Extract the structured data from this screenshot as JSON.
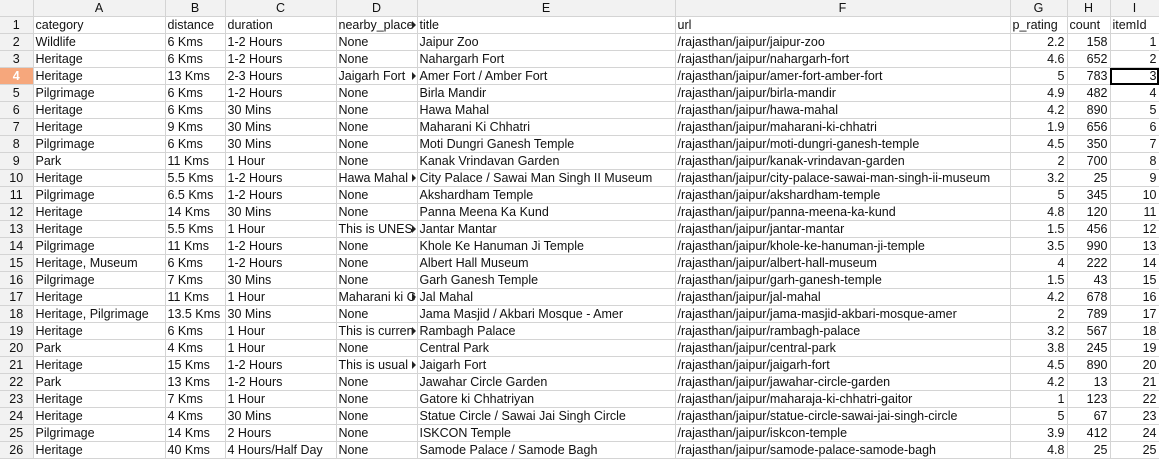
{
  "columns": [
    "A",
    "B",
    "C",
    "D",
    "E",
    "F",
    "G",
    "H",
    "I"
  ],
  "header_row": {
    "row_num": "1",
    "cells": [
      "category",
      "distance",
      "duration",
      "nearby_place",
      "title",
      "url",
      "p_rating",
      "count",
      "itemId"
    ]
  },
  "rows": [
    {
      "n": "2",
      "category": "Wildlife",
      "distance": "6 Kms",
      "duration": "1-2 Hours",
      "nearby": "None",
      "title": "Jaipur Zoo",
      "url": "/rajasthan/jaipur/jaipur-zoo",
      "rating": "2.2",
      "count": "158",
      "id": "1"
    },
    {
      "n": "3",
      "category": "Heritage",
      "distance": "6 Kms",
      "duration": "1-2 Hours",
      "nearby": "None",
      "title": "Nahargarh Fort",
      "url": "/rajasthan/jaipur/nahargarh-fort",
      "rating": "4.6",
      "count": "652",
      "id": "2"
    },
    {
      "n": "4",
      "category": "Heritage",
      "distance": "13 Kms",
      "duration": "2-3 Hours",
      "nearby": "Jaigarh Fort",
      "title": "Amer Fort / Amber Fort",
      "url": "/rajasthan/jaipur/amer-fort-amber-fort",
      "rating": "5",
      "count": "783",
      "id": "3"
    },
    {
      "n": "5",
      "category": "Pilgrimage",
      "distance": "6 Kms",
      "duration": "1-2 Hours",
      "nearby": "None",
      "title": "Birla Mandir",
      "url": "/rajasthan/jaipur/birla-mandir",
      "rating": "4.9",
      "count": "482",
      "id": "4"
    },
    {
      "n": "6",
      "category": "Heritage",
      "distance": "6 Kms",
      "duration": "30 Mins",
      "nearby": "None",
      "title": "Hawa Mahal",
      "url": "/rajasthan/jaipur/hawa-mahal",
      "rating": "4.2",
      "count": "890",
      "id": "5"
    },
    {
      "n": "7",
      "category": "Heritage",
      "distance": "9 Kms",
      "duration": "30 Mins",
      "nearby": "None",
      "title": "Maharani Ki Chhatri",
      "url": "/rajasthan/jaipur/maharani-ki-chhatri",
      "rating": "1.9",
      "count": "656",
      "id": "6"
    },
    {
      "n": "8",
      "category": "Pilgrimage",
      "distance": "6 Kms",
      "duration": "30 Mins",
      "nearby": "None",
      "title": "Moti Dungri Ganesh Temple",
      "url": "/rajasthan/jaipur/moti-dungri-ganesh-temple",
      "rating": "4.5",
      "count": "350",
      "id": "7"
    },
    {
      "n": "9",
      "category": "Park",
      "distance": "11 Kms",
      "duration": "1 Hour",
      "nearby": "None",
      "title": "Kanak Vrindavan Garden",
      "url": "/rajasthan/jaipur/kanak-vrindavan-garden",
      "rating": "2",
      "count": "700",
      "id": "8"
    },
    {
      "n": "10",
      "category": "Heritage",
      "distance": "5.5 Kms",
      "duration": "1-2 Hours",
      "nearby": "Hawa Mahal",
      "title": "City Palace / Sawai Man Singh II Museum",
      "url": "/rajasthan/jaipur/city-palace-sawai-man-singh-ii-museum",
      "rating": "3.2",
      "count": "25",
      "id": "9"
    },
    {
      "n": "11",
      "category": "Pilgrimage",
      "distance": "6.5 Kms",
      "duration": "1-2 Hours",
      "nearby": "None",
      "title": "Akshardham Temple",
      "url": "/rajasthan/jaipur/akshardham-temple",
      "rating": "5",
      "count": "345",
      "id": "10"
    },
    {
      "n": "12",
      "category": "Heritage",
      "distance": "14 Kms",
      "duration": "30 Mins",
      "nearby": "None",
      "title": "Panna Meena Ka Kund",
      "url": "/rajasthan/jaipur/panna-meena-ka-kund",
      "rating": "4.8",
      "count": "120",
      "id": "11"
    },
    {
      "n": "13",
      "category": "Heritage",
      "distance": "5.5 Kms",
      "duration": "1 Hour",
      "nearby": "This is UNES",
      "title": "Jantar Mantar",
      "url": "/rajasthan/jaipur/jantar-mantar",
      "rating": "1.5",
      "count": "456",
      "id": "12"
    },
    {
      "n": "14",
      "category": "Pilgrimage",
      "distance": "11 Kms",
      "duration": "1-2 Hours",
      "nearby": "None",
      "title": "Khole Ke Hanuman Ji Temple",
      "url": "/rajasthan/jaipur/khole-ke-hanuman-ji-temple",
      "rating": "3.5",
      "count": "990",
      "id": "13"
    },
    {
      "n": "15",
      "category": "Heritage, Museum",
      "distance": "6 Kms",
      "duration": "1-2 Hours",
      "nearby": "None",
      "title": "Albert Hall Museum",
      "url": "/rajasthan/jaipur/albert-hall-museum",
      "rating": "4",
      "count": "222",
      "id": "14"
    },
    {
      "n": "16",
      "category": "Pilgrimage",
      "distance": "7 Kms",
      "duration": "30 Mins",
      "nearby": "None",
      "title": "Garh Ganesh Temple",
      "url": "/rajasthan/jaipur/garh-ganesh-temple",
      "rating": "1.5",
      "count": "43",
      "id": "15"
    },
    {
      "n": "17",
      "category": "Heritage",
      "distance": "11 Kms",
      "duration": "1 Hour",
      "nearby": "Maharani ki C",
      "title": "Jal Mahal",
      "url": "/rajasthan/jaipur/jal-mahal",
      "rating": "4.2",
      "count": "678",
      "id": "16"
    },
    {
      "n": "18",
      "category": "Heritage, Pilgrimage",
      "distance": "13.5 Kms",
      "duration": "30 Mins",
      "nearby": "None",
      "title": "Jama Masjid / Akbari Mosque - Amer",
      "url": "/rajasthan/jaipur/jama-masjid-akbari-mosque-amer",
      "rating": "2",
      "count": "789",
      "id": "17"
    },
    {
      "n": "19",
      "category": "Heritage",
      "distance": "6 Kms",
      "duration": "1 Hour",
      "nearby": "This is curren",
      "title": "Rambagh Palace",
      "url": "/rajasthan/jaipur/rambagh-palace",
      "rating": "3.2",
      "count": "567",
      "id": "18"
    },
    {
      "n": "20",
      "category": "Park",
      "distance": "4 Kms",
      "duration": "1 Hour",
      "nearby": "None",
      "title": "Central Park",
      "url": "/rajasthan/jaipur/central-park",
      "rating": "3.8",
      "count": "245",
      "id": "19"
    },
    {
      "n": "21",
      "category": "Heritage",
      "distance": "15 Kms",
      "duration": "1-2 Hours",
      "nearby": "This is usual",
      "title": "Jaigarh Fort",
      "url": "/rajasthan/jaipur/jaigarh-fort",
      "rating": "4.5",
      "count": "890",
      "id": "20"
    },
    {
      "n": "22",
      "category": "Park",
      "distance": "13 Kms",
      "duration": "1-2 Hours",
      "nearby": "None",
      "title": "Jawahar Circle Garden",
      "url": "/rajasthan/jaipur/jawahar-circle-garden",
      "rating": "4.2",
      "count": "13",
      "id": "21"
    },
    {
      "n": "23",
      "category": "Heritage",
      "distance": "7 Kms",
      "duration": "1 Hour",
      "nearby": "None",
      "title": "Gatore ki Chhatriyan",
      "url": "/rajasthan/jaipur/maharaja-ki-chhatri-gaitor",
      "rating": "1",
      "count": "123",
      "id": "22"
    },
    {
      "n": "24",
      "category": "Heritage",
      "distance": "4 Kms",
      "duration": "30 Mins",
      "nearby": "None",
      "title": "Statue Circle / Sawai Jai Singh Circle",
      "url": "/rajasthan/jaipur/statue-circle-sawai-jai-singh-circle",
      "rating": "5",
      "count": "67",
      "id": "23"
    },
    {
      "n": "25",
      "category": "Pilgrimage",
      "distance": "14 Kms",
      "duration": "2 Hours",
      "nearby": "None",
      "title": "ISKCON Temple",
      "url": "/rajasthan/jaipur/iskcon-temple",
      "rating": "3.9",
      "count": "412",
      "id": "24"
    },
    {
      "n": "26",
      "category": "Heritage",
      "distance": "40 Kms",
      "duration": "4 Hours/Half Day",
      "nearby": "None",
      "title": "Samode Palace / Samode Bagh",
      "url": "/rajasthan/jaipur/samode-palace-samode-bagh",
      "rating": "4.8",
      "count": "25",
      "id": "25"
    }
  ],
  "colors": {
    "selected_row_header": "#f6a77c",
    "header_bg": "#f2f2f2",
    "grid_line": "#d4d4d4"
  }
}
